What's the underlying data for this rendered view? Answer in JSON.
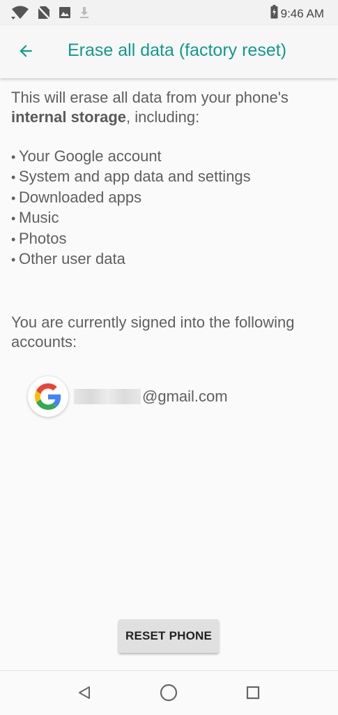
{
  "status_bar": {
    "time": "9:46 AM",
    "icons": [
      "wifi-icon",
      "no-sim-icon",
      "image-icon",
      "download-icon",
      "battery-icon"
    ]
  },
  "app_bar": {
    "title": "Erase all data (factory reset)",
    "back_icon": "arrow-back-icon",
    "accent_color": "#119a8c"
  },
  "content": {
    "intro_text": "This will erase all data from your phone's",
    "intro_bold": "internal storage",
    "intro_suffix": ", including:",
    "bullets": [
      "Your Google account",
      "System and app data and settings",
      "Downloaded apps",
      "Music",
      "Photos",
      "Other user data"
    ],
    "accounts_text": "You are currently signed into the following accounts:",
    "account": {
      "email_suffix": "@gmail.com",
      "icon": "google-logo-icon"
    }
  },
  "actions": {
    "reset_label": "RESET PHONE"
  },
  "nav_bar": {
    "icons": [
      "back-triangle-icon",
      "home-circle-icon",
      "recents-square-icon"
    ]
  }
}
